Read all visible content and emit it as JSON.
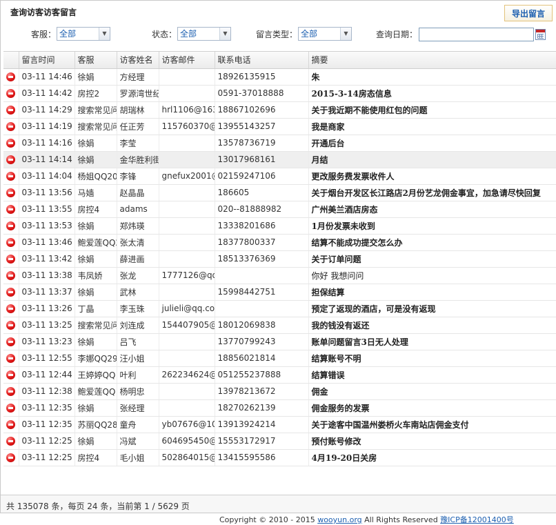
{
  "panel": {
    "title": "查询访客访客留言",
    "export_label": "导出留言"
  },
  "filters": {
    "agent_label": "客服：",
    "agent_value": "全部",
    "status_label": "状态：",
    "status_value": "全部",
    "type_label": "留言类型：",
    "type_value": "全部",
    "date_label": "查询日期：",
    "date_value": ""
  },
  "table": {
    "columns": [
      "留言时间",
      "客服",
      "访客姓名",
      "访客邮件",
      "联系电话",
      "摘要"
    ],
    "rows": [
      {
        "time": "03-11 14:46",
        "agent": "徐娟",
        "name": "方经理",
        "email": "",
        "phone": "18926135915",
        "summary": "朱",
        "bold": true
      },
      {
        "time": "03-11 14:42",
        "agent": "房控2",
        "name": "罗源湾世纪",
        "email": "",
        "phone": "0591-37018888",
        "summary": "2015-3-14房态信息",
        "bold": true
      },
      {
        "time": "03-11 14:29",
        "agent": "搜索常见问",
        "name": "胡瑞林",
        "email": "hrl1106@163.",
        "phone": "18867102696",
        "summary": "关于我近期不能使用红包的问题",
        "bold": true
      },
      {
        "time": "03-11 14:19",
        "agent": "搜索常见问",
        "name": "任正芳",
        "email": "115760370@q",
        "phone": "13955143257",
        "summary": "我是商家",
        "bold": true
      },
      {
        "time": "03-11 14:16",
        "agent": "徐娟",
        "name": "李莹",
        "email": "",
        "phone": "13578736719",
        "summary": "开通后台",
        "bold": true
      },
      {
        "time": "03-11 14:14",
        "agent": "徐娟",
        "name": "金华胜利街",
        "email": "",
        "phone": "13017968161",
        "summary": "月结",
        "bold": true,
        "selected": true
      },
      {
        "time": "03-11 14:04",
        "agent": "杨姐QQ20",
        "name": "李锋",
        "email": "gnefux2001@",
        "phone": "02159247106",
        "summary": "更改服务费发票收件人",
        "bold": true
      },
      {
        "time": "03-11 13:56",
        "agent": "马嫱",
        "name": "赵晶晶",
        "email": "",
        "phone": "186605",
        "summary": "关于烟台开发区长江路店2月份艺龙佣金事宜，加急请尽快回复",
        "bold": true
      },
      {
        "time": "03-11 13:55",
        "agent": "房控4",
        "name": "adams",
        "email": "",
        "phone": "020--81888982",
        "summary": "广州美兰酒店房态",
        "bold": true
      },
      {
        "time": "03-11 13:53",
        "agent": "徐娟",
        "name": "郑炜瑛",
        "email": "",
        "phone": "13338201686",
        "summary": "1月份发票未收到",
        "bold": true
      },
      {
        "time": "03-11 13:46",
        "agent": "鲍爱莲QQ2",
        "name": "张太清",
        "email": "",
        "phone": "18377800337",
        "summary": "结算不能成功提交怎么办",
        "bold": true
      },
      {
        "time": "03-11 13:42",
        "agent": "徐娟",
        "name": "薛进画",
        "email": "",
        "phone": "18513376369",
        "summary": "关于订单问题",
        "bold": true
      },
      {
        "time": "03-11 13:38",
        "agent": "韦凤娇",
        "name": "张龙",
        "email": "1777126@qq.",
        "phone": "",
        "summary": "你好 我想问问",
        "bold": false
      },
      {
        "time": "03-11 13:37",
        "agent": "徐娟",
        "name": "武林",
        "email": "",
        "phone": "15998442751",
        "summary": "担保结算",
        "bold": true
      },
      {
        "time": "03-11 13:26",
        "agent": "丁晶",
        "name": "李玉珠",
        "email": "julieli@qq.com",
        "phone": "",
        "summary": "预定了返现的酒店，可是没有返现",
        "bold": true
      },
      {
        "time": "03-11 13:25",
        "agent": "搜索常见问",
        "name": "刘连成",
        "email": "154407905@c",
        "phone": "18012069838",
        "summary": "我的钱没有返还",
        "bold": true
      },
      {
        "time": "03-11 13:23",
        "agent": "徐娟",
        "name": "吕飞",
        "email": "",
        "phone": "13770799243",
        "summary": "账单问题留言3日无人处理",
        "bold": true
      },
      {
        "time": "03-11 12:55",
        "agent": "李娜QQ29",
        "name": "汪小姐",
        "email": "",
        "phone": "18856021814",
        "summary": "结算账号不明",
        "bold": true
      },
      {
        "time": "03-11 12:44",
        "agent": "王婷婷QQ",
        "name": "叶利",
        "email": "262234624@c",
        "phone": "051255237888",
        "summary": "结算错误",
        "bold": true
      },
      {
        "time": "03-11 12:38",
        "agent": "鲍爱莲QQ",
        "name": "杨明忠",
        "email": "",
        "phone": "13978213672",
        "summary": "佣金",
        "bold": true
      },
      {
        "time": "03-11 12:35",
        "agent": "徐娟",
        "name": "张经理",
        "email": "",
        "phone": "18270262139",
        "summary": "佣金服务的发票",
        "bold": true
      },
      {
        "time": "03-11 12:35",
        "agent": "苏丽QQ28",
        "name": "童舟",
        "email": "yb07676@10(",
        "phone": "13913924214",
        "summary": "关于途客中国温州娄桥火车南站店佣金支付",
        "bold": true
      },
      {
        "time": "03-11 12:25",
        "agent": "徐娟",
        "name": "冯斌",
        "email": "604695450@c",
        "phone": "15553172917",
        "summary": "预付账号修改",
        "bold": true
      },
      {
        "time": "03-11 12:25",
        "agent": "房控4",
        "name": "毛小姐",
        "email": "502864015@c",
        "phone": "13415595586",
        "summary": "4月19-20日关房",
        "bold": true
      }
    ]
  },
  "footer": {
    "summary": "共 135078 条，每页 24 条，当前第 1 / 5629 页"
  },
  "copyright": {
    "text": "Copyright © 2010 - 2015 ",
    "site": "wooyun.org",
    "rights": " All Rights Reserved ",
    "icp": "豫ICP备12001400号"
  },
  "colors": {
    "link": "#1c5fb0",
    "stop_icon": "#e01818",
    "selected_row": "#efefef"
  },
  "icons": {
    "row_status": "stop-icon",
    "calendar": "calendar-icon",
    "dropdown": "chevron-down-icon"
  }
}
